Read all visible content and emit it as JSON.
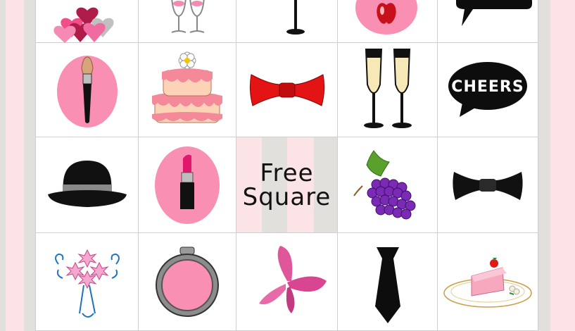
{
  "board": {
    "free_square": {
      "line1": "Free",
      "line2": "Square"
    },
    "speech_bubble_text": "CHEERS"
  },
  "rows": [
    [
      "hearts-icon",
      "wine-glasses-icon",
      "candle-icon",
      "apple-icon",
      "speech-bubble-icon"
    ],
    [
      "makeup-brush-icon",
      "cake-icon",
      "red-bow-tie-icon",
      "champagne-flutes-icon",
      "cheers-bubble-icon"
    ],
    [
      "bowler-hat-icon",
      "lipstick-icon",
      "free-square",
      "grapes-icon",
      "black-bow-tie-icon"
    ],
    [
      "bouquet-icon",
      "compact-mirror-icon",
      "butterfly-icon",
      "necktie-icon",
      "cake-slice-icon"
    ]
  ],
  "colors": {
    "pink": "#f98fb3",
    "light_pink": "#fbe3e6",
    "grey": "#e2e0dc",
    "red": "#e41414",
    "black": "#0d0d0d",
    "purple": "#7a2ab5"
  }
}
